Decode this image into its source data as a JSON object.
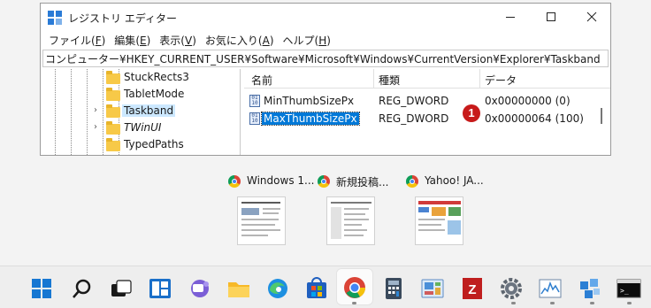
{
  "window": {
    "title": "レジストリ エディター",
    "menu": [
      {
        "label": "ファイル",
        "key": "F"
      },
      {
        "label": "編集",
        "key": "E"
      },
      {
        "label": "表示",
        "key": "V"
      },
      {
        "label": "お気に入り",
        "key": "A"
      },
      {
        "label": "ヘルプ",
        "key": "H"
      }
    ],
    "address": "コンピューター¥HKEY_CURRENT_USER¥Software¥Microsoft¥Windows¥CurrentVersion¥Explorer¥Taskband"
  },
  "tree": {
    "items": [
      {
        "label": "StuckRects3"
      },
      {
        "label": "TabletMode"
      },
      {
        "label": "Taskband",
        "selected": true
      },
      {
        "label": "TWinUI"
      },
      {
        "label": "TypedPaths"
      }
    ]
  },
  "list": {
    "columns": [
      "名前",
      "種類",
      "データ"
    ],
    "rows": [
      {
        "name": "MinThumbSizePx",
        "type": "REG_DWORD",
        "data": "0x00000000 (0)"
      },
      {
        "name": "MaxThumbSizePx",
        "type": "REG_DWORD",
        "data": "0x00000064 (100)",
        "selected": true
      }
    ],
    "badge": "1"
  },
  "thumbnails": [
    {
      "title": "Windows 1...",
      "icon": "chrome-icon"
    },
    {
      "title": "新規投稿...",
      "icon": "chrome-icon"
    },
    {
      "title": "Yahoo! JA...",
      "icon": "chrome-icon"
    }
  ],
  "taskbar": {
    "icons": [
      "start-icon",
      "search-icon",
      "task-view-icon",
      "widgets-icon",
      "teams-chat-icon",
      "file-explorer-icon",
      "edge-icon",
      "store-icon",
      "chrome-icon",
      "calculator-icon",
      "control-panel-icon",
      "filezilla-icon",
      "settings-icon",
      "performance-monitor-icon",
      "registry-editor-icon",
      "terminal-icon"
    ],
    "active": "chrome-icon"
  },
  "colors": {
    "accent": "#0078d7",
    "badge": "#c71a1a",
    "folder": "#f7c948"
  }
}
